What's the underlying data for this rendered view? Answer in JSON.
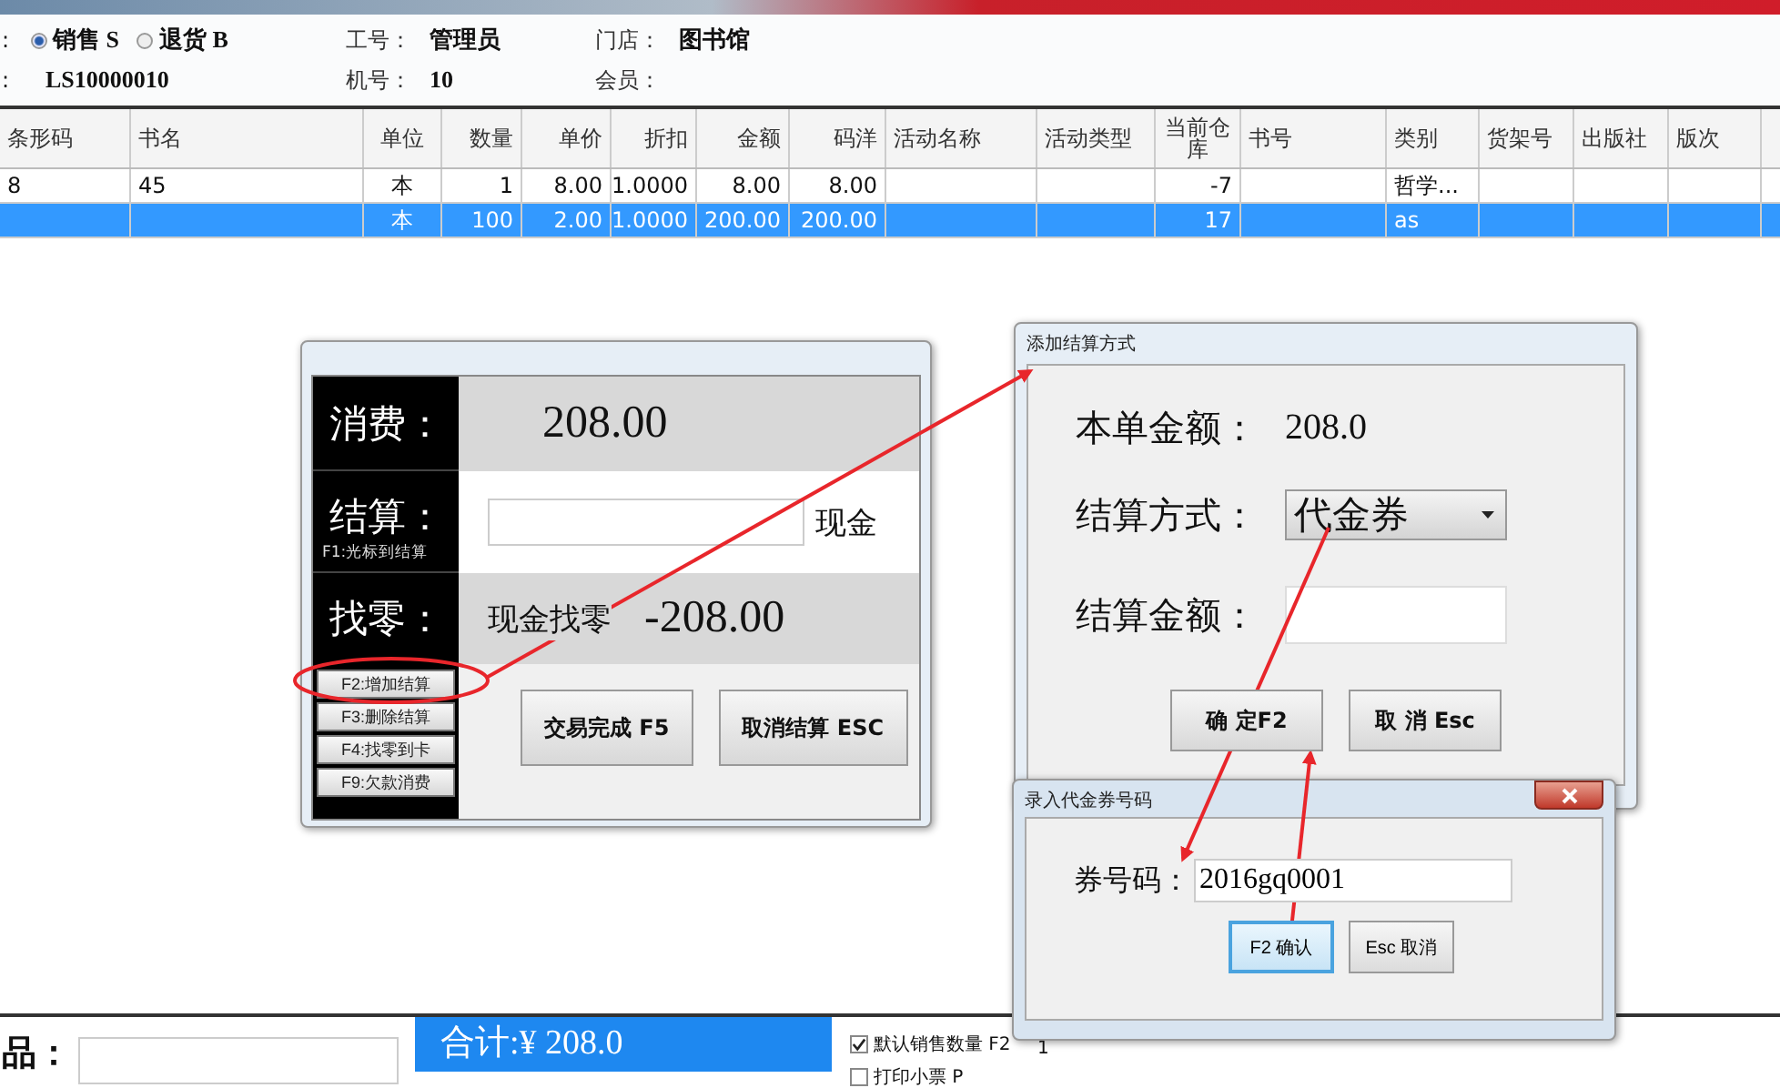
{
  "header": {
    "rows": [
      {
        "prefix": ":",
        "radios": [
          {
            "label": "销售 S",
            "selected": true
          },
          {
            "label": "退货 B",
            "selected": false
          }
        ],
        "fields": [
          {
            "label": "工号：",
            "value": "管理员"
          },
          {
            "label": "门店：",
            "value": "图书馆"
          }
        ]
      },
      {
        "prefix": ":",
        "value": "LS10000010",
        "fields": [
          {
            "label": "机号：",
            "value": "10"
          },
          {
            "label": "会员："
          }
        ]
      }
    ]
  },
  "table": {
    "columns": [
      "条形码",
      "书名",
      "单位",
      "数量",
      "单价",
      "折扣",
      "金额",
      "码洋",
      "活动名称",
      "活动类型",
      "当前仓库",
      "书号",
      "类别",
      "货架号",
      "出版社",
      "版次"
    ],
    "rows": [
      {
        "selected": false,
        "cells": [
          "8",
          "45",
          "本",
          "1",
          "8.00",
          "1.0000",
          "8.00",
          "8.00",
          "",
          "",
          "-7",
          "",
          "哲学...",
          "",
          "",
          ""
        ]
      },
      {
        "selected": true,
        "cells": [
          "",
          "",
          "本",
          "100",
          "2.00",
          "1.0000",
          "200.00",
          "200.00",
          "",
          "",
          "17",
          "",
          "as",
          "",
          "",
          ""
        ]
      }
    ]
  },
  "settle_panel": {
    "rows": [
      {
        "label": "消费：",
        "value": "208.00"
      },
      {
        "label": "结算：",
        "hint": "F1:光标到结算",
        "input": "",
        "suffix": "现金"
      },
      {
        "label": "找零：",
        "caption": "现金找零",
        "value": "-208.00"
      }
    ],
    "side_buttons": [
      "F2:增加结算",
      "F3:删除结算",
      "F4:找零到卡",
      "F9:欠款消费"
    ],
    "buttons": [
      "交易完成 F5",
      "取消结算 ESC"
    ]
  },
  "add_payment_dialog": {
    "title": "添加结算方式",
    "amount_label": "本单金额：",
    "amount": "208.0",
    "method_label": "结算方式：",
    "method": "代金券",
    "sum_label": "结算金额：",
    "buttons": [
      "确 定F2",
      "取 消 Esc"
    ]
  },
  "voucher_dialog": {
    "title": "录入代金券号码",
    "field_label": "券号码：",
    "field_value": "2016gq0001",
    "buttons": [
      {
        "label": "F2 确认",
        "focused": true
      },
      {
        "label": "Esc 取消",
        "focused": false
      }
    ]
  },
  "bottom": {
    "product_label": "品：",
    "total": "合计:¥ 208.0",
    "checkboxes": [
      {
        "label": "默认销售数量 F2",
        "checked": true
      },
      {
        "label": "打印小票 P",
        "checked": false
      }
    ],
    "spin_value": "1"
  }
}
